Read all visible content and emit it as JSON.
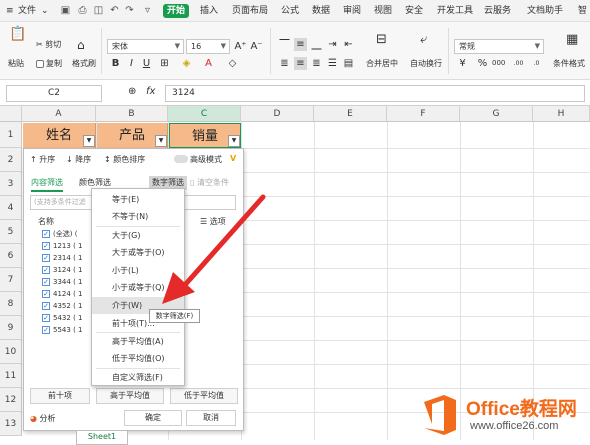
{
  "menubar": {
    "file": "文件",
    "start": "开始",
    "items": [
      "插入",
      "页面布局",
      "公式",
      "数据",
      "审阅",
      "视图",
      "安全",
      "开发工具",
      "云服务",
      "文档助手",
      "智"
    ]
  },
  "ribbon": {
    "paste": "粘贴",
    "cut": "剪切",
    "copy": "复制",
    "format_painter": "格式刷",
    "font_name": "宋体",
    "font_size": "16",
    "merge": "合并居中",
    "wrap": "自动换行",
    "number_format": "常规",
    "conditional": "条件格式"
  },
  "formula_bar": {
    "name_box": "C2",
    "fx": "fx",
    "value": "3124"
  },
  "grid": {
    "columns": [
      "A",
      "B",
      "C",
      "D",
      "E",
      "F",
      "G",
      "H"
    ],
    "rows": [
      "1",
      "2",
      "3",
      "4",
      "5",
      "6",
      "7",
      "8",
      "9",
      "10",
      "11",
      "12",
      "13"
    ],
    "header_cells": [
      "姓名",
      "产品",
      "销量"
    ]
  },
  "filter_panel": {
    "sort_asc": "升序",
    "sort_desc": "降序",
    "color_sort": "颜色排序",
    "advanced": "高级模式",
    "tab_content": "内容筛选",
    "tab_color": "颜色筛选",
    "tab_number": "数字筛选",
    "clear": "清空条件",
    "search_placeholder": "(支持多条件过滤",
    "name_col": "名称",
    "options": "选项",
    "list": [
      "(全选)",
      "1213",
      "2314",
      "3124",
      "3344",
      "4124",
      "4352",
      "5432",
      "5543"
    ],
    "list_counts": [
      "(",
      "( 1",
      "( 1",
      "( 1",
      "( 1",
      "( 1",
      "( 1",
      "( 1",
      "( 1"
    ],
    "top10": "前十项",
    "above_avg": "高于平均值",
    "below_avg": "低于平均值",
    "analysis": "分析",
    "ok": "确定",
    "cancel": "取消"
  },
  "number_menu": {
    "items": [
      "等于(E)",
      "不等于(N)",
      "大于(G)",
      "大于或等于(O)",
      "小于(L)",
      "小于或等于(Q)",
      "介于(W)",
      "前十项(T)...",
      "高于平均值(A)",
      "低于平均值(O)",
      "自定义筛选(F)"
    ],
    "tooltip": "数字筛选(F)"
  },
  "sheet_tab": "Sheet1",
  "watermark": {
    "brand": "Office教程网",
    "url": "www.office26.com"
  },
  "colors": {
    "accent_green": "#1a9c50",
    "header_fill": "#f6b98a",
    "arrow_red": "#e52a2a",
    "logo_orange": "#f26a1b"
  }
}
